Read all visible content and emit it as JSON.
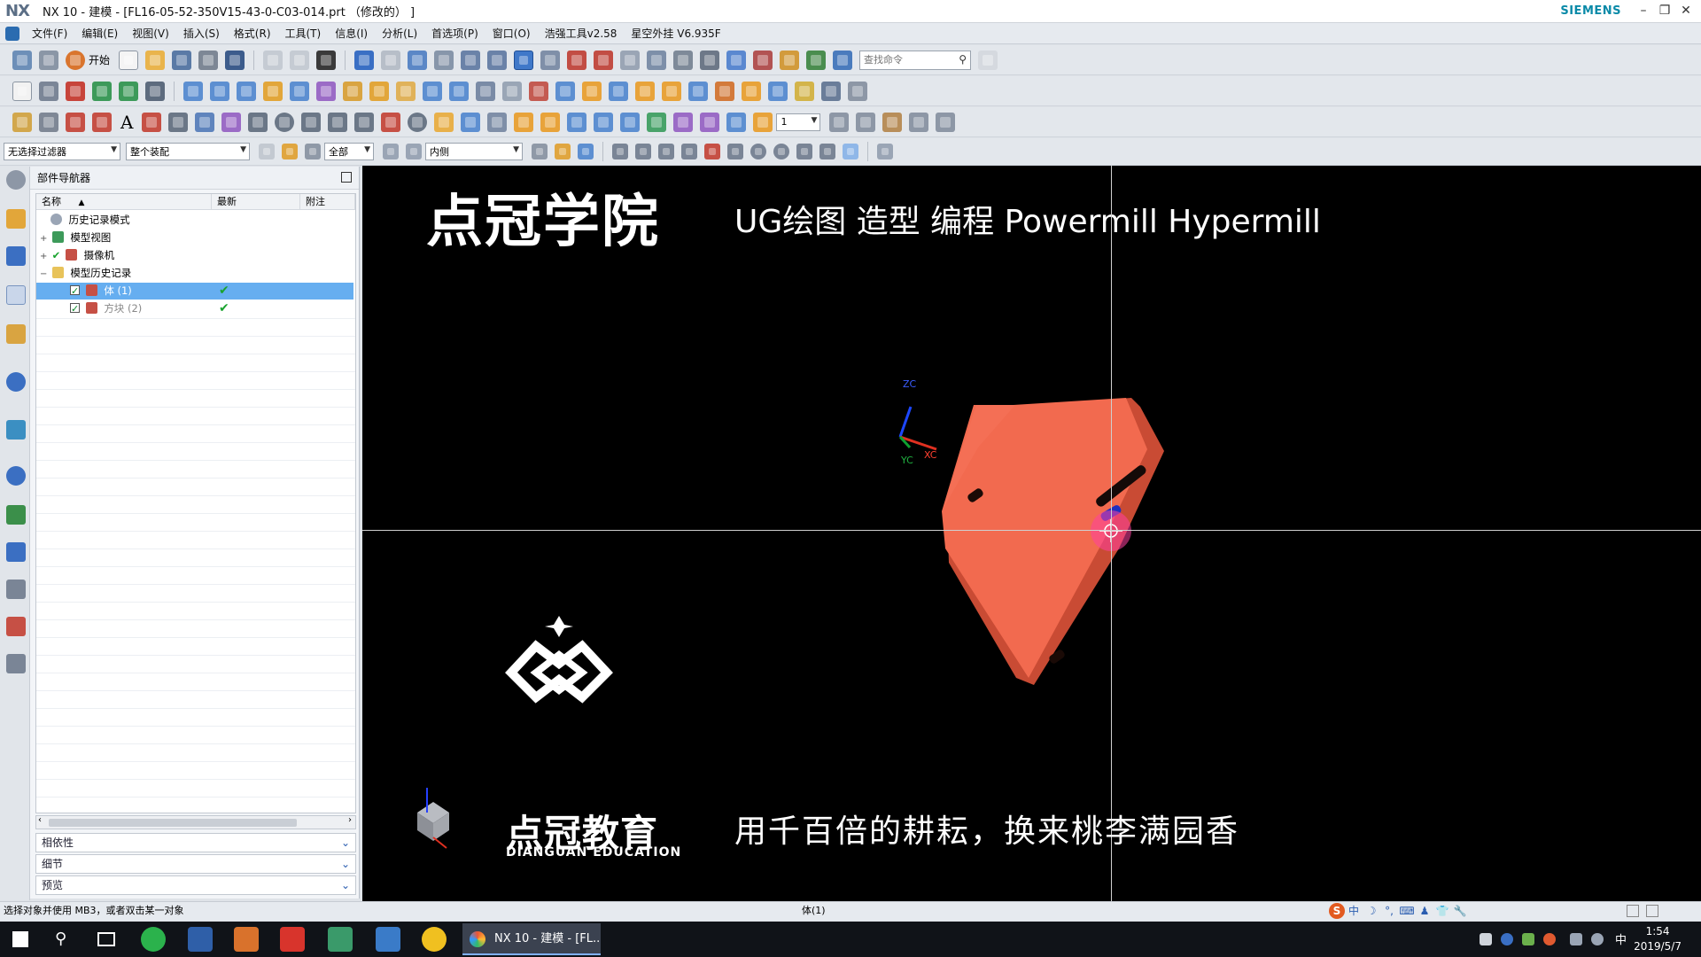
{
  "window": {
    "app_logo": "NX",
    "title": "NX 10 - 建模 - [FL16-05-52-350V15-43-0-C03-014.prt （修改的） ]",
    "brand": "SIEMENS"
  },
  "menu": [
    "文件(F)",
    "编辑(E)",
    "视图(V)",
    "插入(S)",
    "格式(R)",
    "工具(T)",
    "信息(I)",
    "分析(L)",
    "首选项(P)",
    "窗口(O)",
    "浩强工具v2.58",
    "星空外挂 V6.935F"
  ],
  "toolbar": {
    "start_label": "开始",
    "search_placeholder": "查找命令",
    "layer_value": "1"
  },
  "filters": {
    "selection_filter": "无选择过滤器",
    "assembly_scope": "整个装配",
    "type_filter": "全部",
    "rectangle_mode": "内侧"
  },
  "navigator": {
    "title": "部件导航器",
    "columns": [
      "名称",
      "最新",
      "附注"
    ],
    "rows": [
      {
        "name": "历史记录模式",
        "expander": "",
        "checked": false,
        "latest": "",
        "selected": false
      },
      {
        "name": "模型视图",
        "expander": "+",
        "checked": false,
        "latest": "",
        "selected": false
      },
      {
        "name": "摄像机",
        "expander": "+",
        "checked": true,
        "latest": "",
        "selected": false
      },
      {
        "name": "模型历史记录",
        "expander": "−",
        "checked": false,
        "latest": "",
        "selected": false
      },
      {
        "name": "体 (1)",
        "expander": "",
        "checked": true,
        "latest": "✔",
        "selected": true
      },
      {
        "name": "方块 (2)",
        "expander": "",
        "checked": true,
        "latest": "✔",
        "selected": false
      }
    ],
    "panels": [
      "相依性",
      "细节",
      "预览"
    ]
  },
  "viewport": {
    "brand_title": "点冠学院",
    "brand_subtitle": "UG绘图 造型 编程 Powermill Hypermill",
    "edu_name": "点冠教育",
    "edu_name_en": "DIANGUAN EDUCATION",
    "motto": "用千百倍的耕耘，换来桃李满园香",
    "axis_labels": {
      "z": "ZC",
      "y": "YC",
      "x": "XC"
    },
    "part_color": "#f26a4f",
    "slot_color": "#1f2fbf"
  },
  "status": {
    "message": "选择对象并使用 MB3，或者双击某一对象",
    "selection": "体(1)"
  },
  "ime": [
    "中",
    "☽",
    "°,",
    "⌨",
    "♟",
    "👕",
    "🔧"
  ],
  "taskbar": {
    "active_window": "NX 10 - 建模 - [FL...",
    "ime_indicator": "中",
    "time": "1:54",
    "date": "2019/5/7"
  }
}
